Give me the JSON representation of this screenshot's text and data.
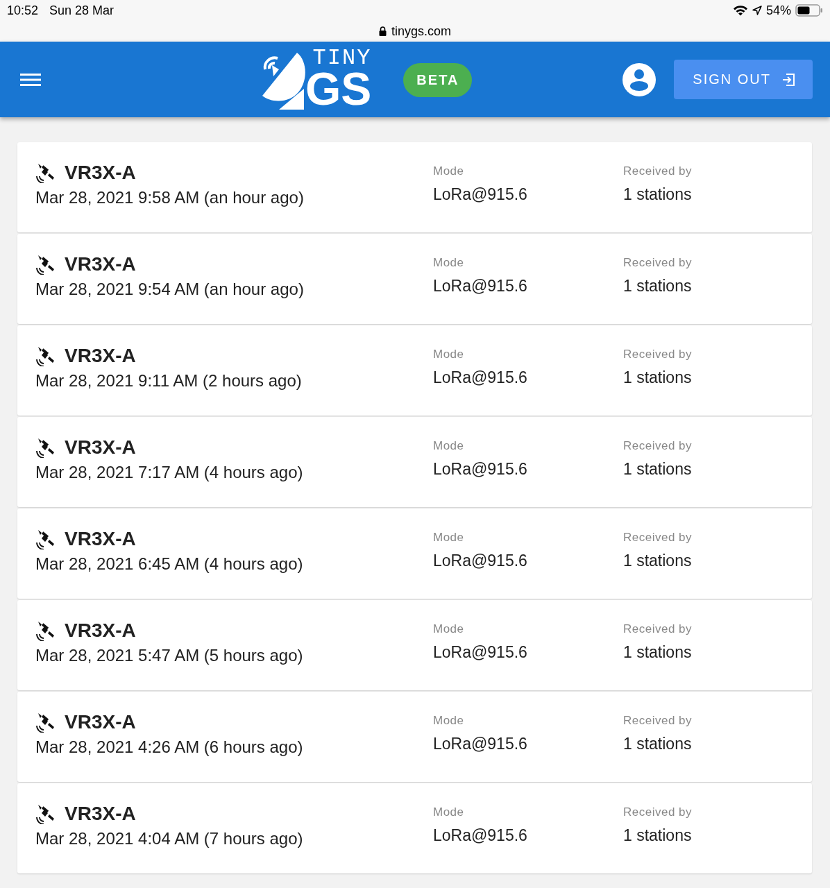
{
  "status_bar": {
    "time": "10:52",
    "date": "Sun 28 Mar",
    "battery": "54%"
  },
  "address_bar": {
    "url": "tinygs.com"
  },
  "header": {
    "logo_top": "TINY",
    "logo_bottom": "GS",
    "badge": "BETA",
    "sign_out": "SIGN OUT"
  },
  "packets": [
    {
      "satellite": "VR3X-A",
      "time": "Mar 28, 2021 9:58 AM (an hour ago)",
      "mode_label": "Mode",
      "mode": "LoRa@915.6",
      "received_label": "Received by",
      "received": "1 stations"
    },
    {
      "satellite": "VR3X-A",
      "time": "Mar 28, 2021 9:54 AM (an hour ago)",
      "mode_label": "Mode",
      "mode": "LoRa@915.6",
      "received_label": "Received by",
      "received": "1 stations"
    },
    {
      "satellite": "VR3X-A",
      "time": "Mar 28, 2021 9:11 AM (2 hours ago)",
      "mode_label": "Mode",
      "mode": "LoRa@915.6",
      "received_label": "Received by",
      "received": "1 stations"
    },
    {
      "satellite": "VR3X-A",
      "time": "Mar 28, 2021 7:17 AM (4 hours ago)",
      "mode_label": "Mode",
      "mode": "LoRa@915.6",
      "received_label": "Received by",
      "received": "1 stations"
    },
    {
      "satellite": "VR3X-A",
      "time": "Mar 28, 2021 6:45 AM (4 hours ago)",
      "mode_label": "Mode",
      "mode": "LoRa@915.6",
      "received_label": "Received by",
      "received": "1 stations"
    },
    {
      "satellite": "VR3X-A",
      "time": "Mar 28, 2021 5:47 AM (5 hours ago)",
      "mode_label": "Mode",
      "mode": "LoRa@915.6",
      "received_label": "Received by",
      "received": "1 stations"
    },
    {
      "satellite": "VR3X-A",
      "time": "Mar 28, 2021 4:26 AM (6 hours ago)",
      "mode_label": "Mode",
      "mode": "LoRa@915.6",
      "received_label": "Received by",
      "received": "1 stations"
    },
    {
      "satellite": "VR3X-A",
      "time": "Mar 28, 2021 4:04 AM (7 hours ago)",
      "mode_label": "Mode",
      "mode": "LoRa@915.6",
      "received_label": "Received by",
      "received": "1 stations"
    }
  ]
}
